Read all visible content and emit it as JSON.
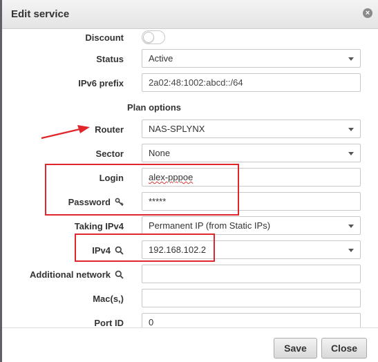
{
  "dialog": {
    "title": "Edit service",
    "close_icon": "close-icon"
  },
  "form": {
    "discount_label": "Discount",
    "discount_on": false,
    "status_label": "Status",
    "status_value": "Active",
    "ipv6_label": "IPv6 prefix",
    "ipv6_value": "2a02:48:1002:abcd::/64",
    "plan_options_label": "Plan options",
    "router_label": "Router",
    "router_value": "NAS-SPLYNX",
    "sector_label": "Sector",
    "sector_value": "None",
    "login_label": "Login",
    "login_value": "alex-pppoe",
    "password_label": "Password",
    "password_value": "*****",
    "taking_ipv4_label": "Taking IPv4",
    "taking_ipv4_value": "Permanent IP (from Static IPs)",
    "ipv4_label": "IPv4",
    "ipv4_value": "192.168.102.2",
    "additional_network_label": "Additional network",
    "additional_network_value": "",
    "mac_label": "Mac(s,)",
    "mac_value": "",
    "port_id_label": "Port ID",
    "port_id_value": "0"
  },
  "footer": {
    "save_label": "Save",
    "close_label": "Close"
  },
  "annotations": {
    "highlight_color": "#e0262a"
  }
}
